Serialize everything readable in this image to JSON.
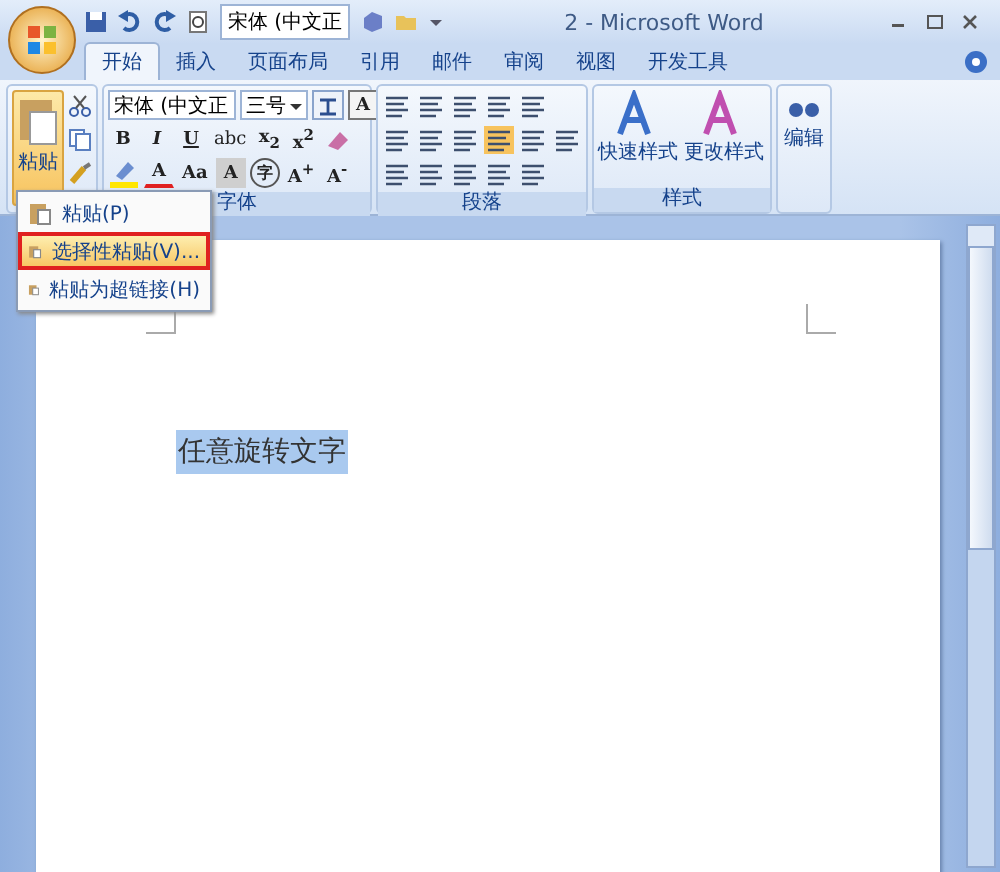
{
  "quick_access": {
    "font_box": "宋体 (中文正"
  },
  "window": {
    "title": "2 - Microsoft Word"
  },
  "tabs": [
    {
      "label": "开始",
      "selected": true
    },
    {
      "label": "插入",
      "selected": false
    },
    {
      "label": "页面布局",
      "selected": false
    },
    {
      "label": "引用",
      "selected": false
    },
    {
      "label": "邮件",
      "selected": false
    },
    {
      "label": "审阅",
      "selected": false
    },
    {
      "label": "视图",
      "selected": false
    },
    {
      "label": "开发工具",
      "selected": false
    }
  ],
  "clipboard": {
    "paste_label": "粘贴"
  },
  "font": {
    "label": "字体",
    "font_name": "宋体 (中文正",
    "font_size": "三号",
    "border_char": "A",
    "format_buttons": [
      "B",
      "I",
      "U",
      "abc",
      "x$_{2}$",
      "x$^{2}$"
    ],
    "effect_buttons": [
      "A",
      "Aa",
      "A",
      "字",
      "A$^{+}$",
      "A$^{-}$"
    ]
  },
  "paragraph": {
    "label": "段落"
  },
  "styles": {
    "label": "样式",
    "buttons": [
      "快速样式",
      "更改样式"
    ]
  },
  "editing": {
    "label": "编辑"
  },
  "paste_menu": [
    {
      "label": "粘贴(P)",
      "selected": false
    },
    {
      "label": "选择性粘贴(V)...",
      "selected": true
    },
    {
      "label": "粘贴为超链接(H)",
      "selected": false
    }
  ],
  "document": {
    "text": "任意旋转文字"
  }
}
